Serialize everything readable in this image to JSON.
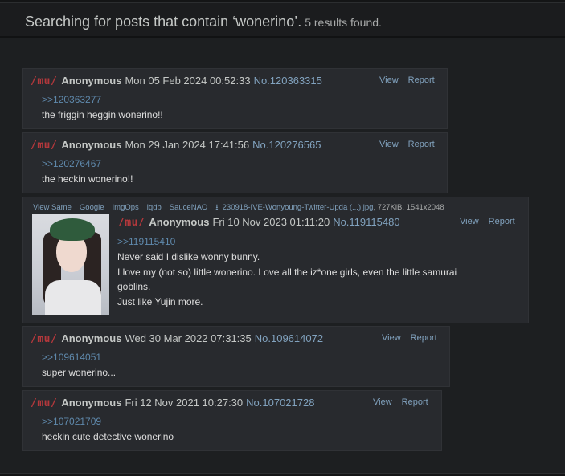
{
  "header": {
    "title_prefix": "Searching for posts that contain ",
    "query": "‘wonerino’.",
    "results": "5 results found."
  },
  "posts": [
    {
      "board": "/mu/",
      "name": "Anonymous",
      "date": "Mon 05 Feb 2024 00:52:33",
      "number": "No.120363315",
      "view": "View",
      "report": "Report",
      "quote": ">>120363277",
      "body": "the friggin heggin wonerino!!"
    },
    {
      "board": "/mu/",
      "name": "Anonymous",
      "date": "Mon 29 Jan 2024 17:41:56",
      "number": "No.120276565",
      "view": "View",
      "report": "Report",
      "quote": ">>120276467",
      "body": "the heckin wonerino!!"
    },
    {
      "file_links": [
        "View Same",
        "Google",
        "ImgOps",
        "iqdb",
        "SauceNAO"
      ],
      "download_icon": "download-icon",
      "filename": "230918-IVE-Wonyoung-Twitter-Upda (...).jpg",
      "fileinfo": ", 727KiB, 1541x2048",
      "board": "/mu/",
      "name": "Anonymous",
      "date": "Fri 10 Nov 2023 01:11:20",
      "number": "No.119115480",
      "view": "View",
      "report": "Report",
      "quote": ">>119115410",
      "lines": [
        "Never said I dislike wonny bunny.",
        "I love my (not so) little wonerino. Love all the iz*one girls, even the little samurai",
        "goblins.",
        "Just like Yujin more."
      ]
    },
    {
      "board": "/mu/",
      "name": "Anonymous",
      "date": "Wed 30 Mar 2022 07:31:35",
      "number": "No.109614072",
      "view": "View",
      "report": "Report",
      "quote": ">>109614051",
      "body": "super wonerino..."
    },
    {
      "board": "/mu/",
      "name": "Anonymous",
      "date": "Fri 12 Nov 2021 10:27:30",
      "number": "No.107021728",
      "view": "View",
      "report": "Report",
      "quote": ">>107021709",
      "body": "heckin cute detective wonerino"
    }
  ],
  "colors": {
    "background": "#1d1f21",
    "post_bg": "#282a2e",
    "board": "#b4383c",
    "link": "#81a2be",
    "quote": "#5f89ac"
  }
}
